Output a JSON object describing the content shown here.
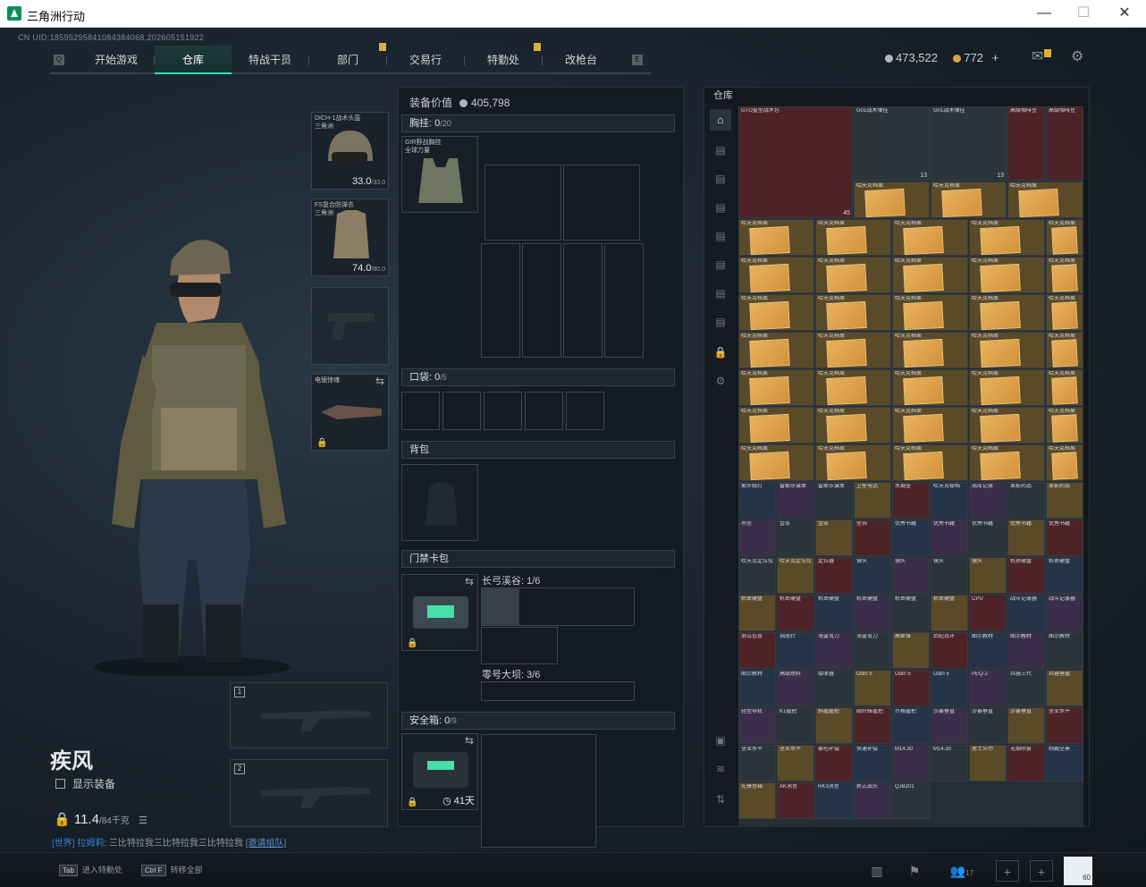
{
  "window": {
    "title": "三角洲行动",
    "controls": [
      "—",
      "☐",
      "✕"
    ]
  },
  "uid": "CN UID:18595295841084384068,202605151922",
  "nav": {
    "left_key": "Q",
    "right_key": "E",
    "tabs": [
      {
        "label": "开始游戏",
        "active": false,
        "badge": false
      },
      {
        "label": "仓库",
        "active": true,
        "badge": false
      },
      {
        "label": "特战干员",
        "active": false,
        "badge": false
      },
      {
        "label": "部门",
        "active": false,
        "badge": true
      },
      {
        "label": "交易行",
        "active": false,
        "badge": false
      },
      {
        "label": "特勤处",
        "active": false,
        "badge": true
      },
      {
        "label": "改枪台",
        "active": false,
        "badge": false
      }
    ]
  },
  "currency": {
    "silver": "473,522",
    "gold": "772",
    "plus": "+"
  },
  "character": {
    "name": "疾风",
    "show_equip": "显示装备",
    "weight": "11.4",
    "weight_max": "/84千克"
  },
  "equip_slots": {
    "helmet": {
      "name": "DICH-1战术头盔",
      "sub": "三角洲",
      "dur": "33.0",
      "max": "/33.0"
    },
    "armor": {
      "name": "FS复合防弹衣",
      "sub": "三角洲",
      "dur": "74.0",
      "max": "/80.0"
    },
    "melee": {
      "name": "电锯惊魂"
    }
  },
  "weapon_slots": [
    "1",
    "2"
  ],
  "mid": {
    "value_label": "装备价值",
    "value": "405,798",
    "chest": {
      "label": "胸挂:",
      "count": "0",
      "cap": "/20",
      "item": "GIR野战胸挂",
      "item_sub": "全球力量"
    },
    "pocket": {
      "label": "口袋:",
      "count": "0",
      "cap": "/5"
    },
    "backpack": {
      "label": "背包"
    },
    "keycard": {
      "label": "门禁卡包",
      "row1": "长弓溪谷: 1/6",
      "row2": "零号大坝: 3/6"
    },
    "safebox": {
      "label": "安全箱:",
      "count": "0",
      "cap": "/9",
      "days": "41天"
    }
  },
  "storage": {
    "label": "仓库"
  },
  "chat": {
    "channel": "[世界]",
    "user": "拉姆莉",
    "text": "三比特拉我三比特拉我三比特拉我",
    "invite": "[邀请组队]"
  },
  "bottom": {
    "hint1_key": "Tab",
    "hint1": "进入特勤处",
    "hint2_key": "Ctrl F",
    "hint2": "转移全部",
    "people": "17",
    "avatar_level": "60"
  },
  "grid_items": {
    "big": [
      {
        "name": "GTO重型战术包",
        "sub": "全球力量",
        "qty": "45"
      },
      {
        "name": "G01战术弹挂",
        "sub": "全球力量",
        "qty": "13"
      },
      {
        "name": "G01战术弹挂",
        "sub": "全球力量",
        "qty": "13"
      },
      {
        "name": "高级咖啡豆"
      },
      {
        "name": "高级咖啡豆"
      }
    ],
    "paper_name": "哈夫克档案",
    "misc": [
      "紫外线灯",
      "雷斯乐谱本",
      "雷斯乐谱本",
      "卫星电话",
      "水烟壶",
      "哈夫克秘档",
      "出库记录",
      "显影药品",
      "显影药品",
      "吊坠",
      "金条",
      "金条",
      "坠饰",
      "优秀书籍",
      "优秀书籍",
      "优秀书籍",
      "优秀书籍",
      "优秀书籍",
      "哈夫克定位仪",
      "哈夫克定位仪",
      "定位器",
      "镜头",
      "镜头",
      "镜头",
      "镜头",
      "机密硬盘",
      "机密硬盘",
      "机密硬盘",
      "机密硬盘",
      "机密硬盘",
      "机密硬盘",
      "机密硬盘",
      "机密硬盘",
      "CPU",
      "战斗记录器",
      "战斗记录器",
      "测试信息",
      "指南针",
      "海盗弯刀",
      "海盗弯刀",
      "高斯锥",
      "后妃耳环",
      "图示教材",
      "图示教材",
      "图示教材",
      "图示教材",
      "高级燃料",
      "接收器",
      "Odin 5",
      "Odin 5",
      "Odin 5",
      "PEQ-2",
      "兵器三代",
      "兵器垂握",
      "轻型导轨",
      "K1握把",
      "斜握握把",
      "碳纤维握把",
      "齐格握把",
      "沙暴垂直",
      "沙暴垂直",
      "沙暴垂直",
      "坚业水平",
      "坚业水平",
      "坚业水平",
      "泰坦补偿",
      "快速补偿",
      "M14.30",
      "M14.30",
      "男士头巾",
      "无烟喷雾",
      "制霸全景",
      "先锋音箱",
      "AK消音",
      "RK3消音",
      "新式出头",
      "QJB201"
    ]
  }
}
